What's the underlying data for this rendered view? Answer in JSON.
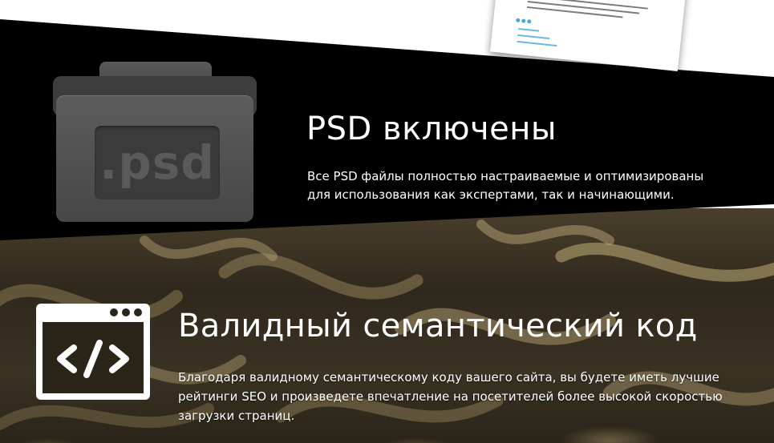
{
  "features": [
    {
      "title": "PSD включены",
      "description": "Все PSD файлы полностью настраиваемые и оптимизированы для использования как экспертами, так и начинающими.",
      "icon": "psd-folder-icon",
      "icon_text": ".psd"
    },
    {
      "title": "Валидный семантический код",
      "description": "Благодаря валидному семантическому коду вашего сайта, вы будете иметь лучшие рейтинги SEO и произведете впечатление на посетителей более высокой скоростью загрузки страниц.",
      "icon": "code-window-icon"
    }
  ],
  "colors": {
    "band_black": "#000000",
    "text": "#ffffff",
    "folder_gray": "#555555",
    "sheet_link_blue": "#4aa8d8"
  }
}
